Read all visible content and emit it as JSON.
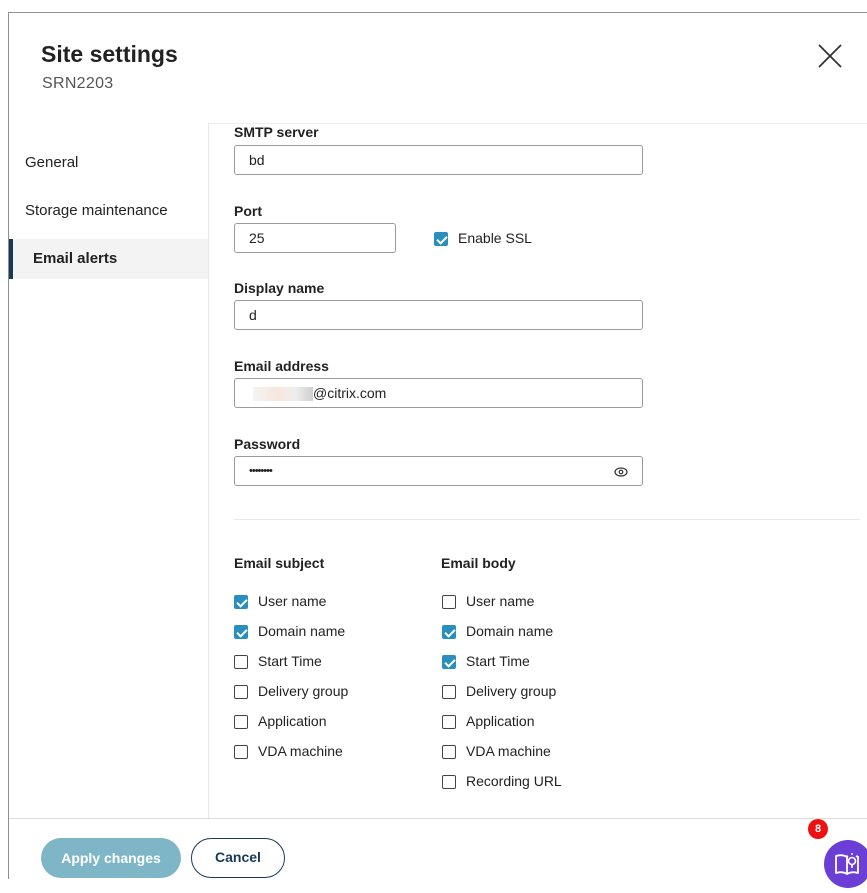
{
  "dialog": {
    "title": "Site settings",
    "subtitle": "SRN2203"
  },
  "sidebar": {
    "items": [
      {
        "label": "General"
      },
      {
        "label": "Storage maintenance"
      },
      {
        "label": "Email alerts",
        "active": true
      }
    ]
  },
  "form": {
    "smtp_server": {
      "label": "SMTP server",
      "value": "bd"
    },
    "port": {
      "label": "Port",
      "value": "25"
    },
    "enable_ssl": {
      "label": "Enable SSL",
      "checked": true
    },
    "display_name": {
      "label": "Display name",
      "value": "d"
    },
    "email_address": {
      "label": "Email address",
      "value": "@citrix.com"
    },
    "password": {
      "label": "Password",
      "value": "••••••••"
    }
  },
  "email_subject": {
    "heading": "Email subject",
    "options": [
      {
        "label": "User name",
        "checked": true
      },
      {
        "label": "Domain name",
        "checked": true
      },
      {
        "label": "Start Time",
        "checked": false
      },
      {
        "label": "Delivery group",
        "checked": false
      },
      {
        "label": "Application",
        "checked": false
      },
      {
        "label": "VDA machine",
        "checked": false
      }
    ]
  },
  "email_body": {
    "heading": "Email body",
    "options": [
      {
        "label": "User name",
        "checked": false
      },
      {
        "label": "Domain name",
        "checked": true
      },
      {
        "label": "Start Time",
        "checked": true
      },
      {
        "label": "Delivery group",
        "checked": false
      },
      {
        "label": "Application",
        "checked": false
      },
      {
        "label": "VDA machine",
        "checked": false
      },
      {
        "label": "Recording URL",
        "checked": false
      }
    ]
  },
  "footer": {
    "apply_label": "Apply changes",
    "cancel_label": "Cancel",
    "help_badge": "8"
  },
  "colors": {
    "accent": "#2a8fbd",
    "primary_dark": "#173a57",
    "apply_disabled": "#7eb6c7",
    "help_purple": "#6b3fd6",
    "badge_red": "#e11"
  }
}
